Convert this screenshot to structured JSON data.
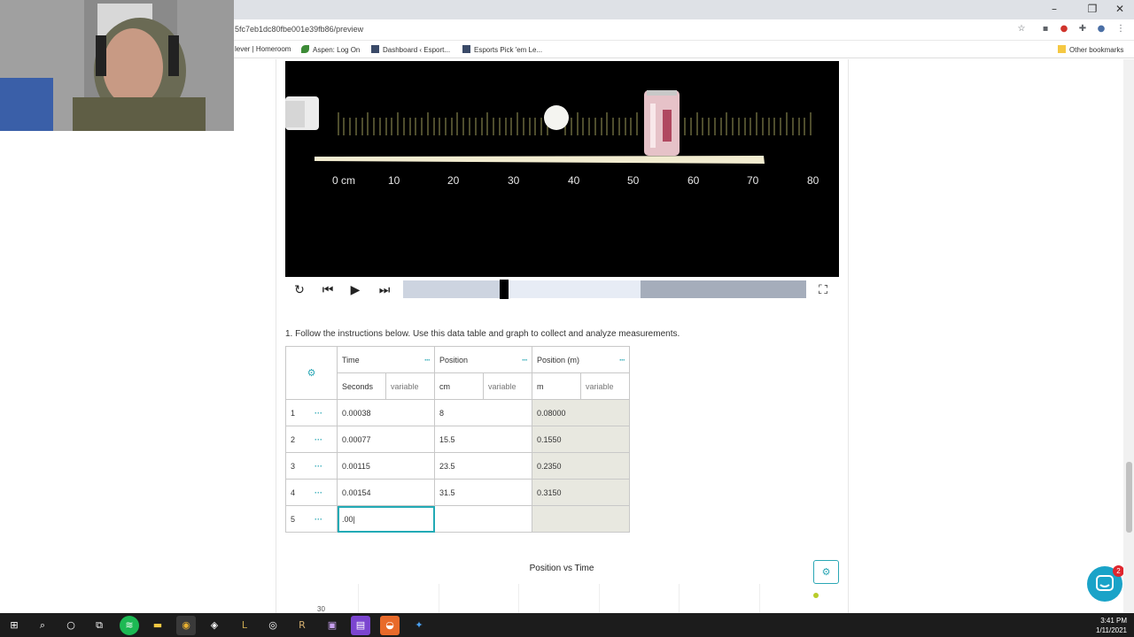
{
  "browser": {
    "url": "5fc7eb1dc80fbe001e39fb86/preview",
    "bookmarks": [
      {
        "label": "lever | Homeroom"
      },
      {
        "label": "Aspen: Log On"
      },
      {
        "label": "Dashboard ‹ Esport..."
      },
      {
        "label": "Esports Pick 'em Le..."
      }
    ],
    "other_bookmarks": "Other bookmarks"
  },
  "video": {
    "ruler_labels": [
      "0 cm",
      "10",
      "20",
      "30",
      "40",
      "50",
      "60",
      "70",
      "80"
    ],
    "progress": 0.25,
    "buffered_start": 0.59
  },
  "question": {
    "text": "1.  Follow the instructions below. Use this data table and graph to collect and analyze measurements."
  },
  "table": {
    "columns": [
      {
        "name": "Time",
        "unit": "Seconds",
        "type": "variable"
      },
      {
        "name": "Position",
        "unit": "cm",
        "type": "variable"
      },
      {
        "name": "Position (m)",
        "unit": "m",
        "type": "variable"
      }
    ],
    "rows": [
      {
        "index": "1",
        "time": "0.00038",
        "position": "8",
        "position_m": "0.08000"
      },
      {
        "index": "2",
        "time": "0.00077",
        "position": "15.5",
        "position_m": "0.1550"
      },
      {
        "index": "3",
        "time": "0.00115",
        "position": "23.5",
        "position_m": "0.2350"
      },
      {
        "index": "4",
        "time": "0.00154",
        "position": "31.5",
        "position_m": "0.3150"
      },
      {
        "index": "5",
        "time": ".00|",
        "position": "",
        "position_m": ""
      }
    ]
  },
  "graph": {
    "title": "Position vs Time",
    "y_tick": "30"
  },
  "chat": {
    "badge": "2"
  },
  "taskbar": {
    "time": "3:41 PM",
    "date": "1/11/2021"
  }
}
